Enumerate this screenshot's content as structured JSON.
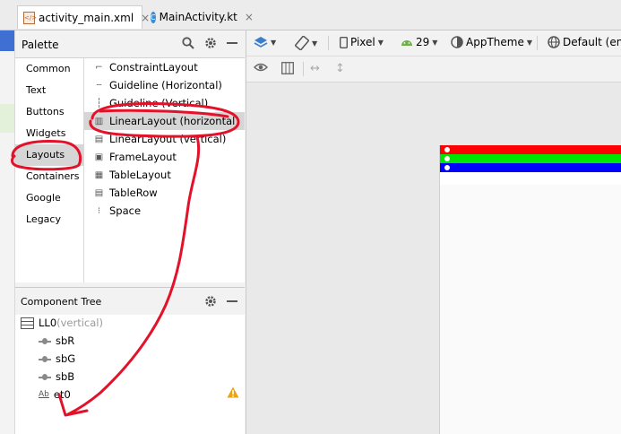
{
  "tabs": [
    {
      "label": "activity_main.xml",
      "icon": "xml-file-icon",
      "close": "×"
    },
    {
      "label": "MainActivity.kt",
      "icon": "kotlin-file-icon",
      "close": "×"
    }
  ],
  "palette": {
    "title": "Palette",
    "categories": [
      "Common",
      "Text",
      "Buttons",
      "Widgets",
      "Layouts",
      "Containers",
      "Google",
      "Legacy"
    ],
    "selected_category": "Layouts",
    "items": [
      {
        "label": "ConstraintLayout",
        "icon": "constraint-layout-icon"
      },
      {
        "label": "Guideline (Horizontal)",
        "icon": "guideline-horizontal-icon"
      },
      {
        "label": "Guideline (Vertical)",
        "icon": "guideline-vertical-icon"
      },
      {
        "label": "LinearLayout (horizontal)",
        "icon": "linear-layout-horizontal-icon"
      },
      {
        "label": "LinearLayout (vertical)",
        "icon": "linear-layout-vertical-icon"
      },
      {
        "label": "FrameLayout",
        "icon": "frame-layout-icon"
      },
      {
        "label": "TableLayout",
        "icon": "table-layout-icon"
      },
      {
        "label": "TableRow",
        "icon": "table-row-icon"
      },
      {
        "label": "Space",
        "icon": "space-icon"
      }
    ],
    "selected_item": "LinearLayout (horizontal)"
  },
  "tree": {
    "title": "Component Tree",
    "root": {
      "id": "LL0",
      "suffix": "(vertical)"
    },
    "children": [
      {
        "id": "sbR",
        "icon": "seekbar-icon"
      },
      {
        "id": "sbG",
        "icon": "seekbar-icon"
      },
      {
        "id": "sbB",
        "icon": "seekbar-icon"
      },
      {
        "id": "et0",
        "icon": "edittext-icon",
        "warning": true
      }
    ],
    "edittext_icon_text": "Ab"
  },
  "toolbar": {
    "device": "Pixel",
    "api": "29",
    "theme": "AppTheme",
    "locale": "Default (en-"
  },
  "preview": {
    "seekbar_colors": [
      "#ff0000",
      "#00e600",
      "#0000ff"
    ]
  },
  "colors": {
    "annotation": "#e3122a",
    "selection": "#d6d6d6",
    "link_blue": "#3f6fd2"
  }
}
